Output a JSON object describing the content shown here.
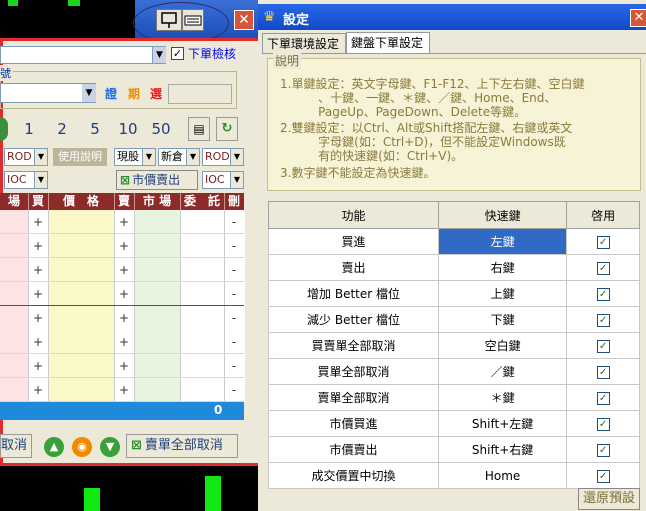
{
  "left_window": {
    "review_label": "下單檢核",
    "account_label": "號",
    "market_tabs": [
      {
        "label": "證",
        "color": "#1f6fe8"
      },
      {
        "label": "期",
        "color": "#f08a00"
      },
      {
        "label": "選",
        "color": "#e82020"
      }
    ],
    "qty_buttons": [
      "1",
      "2",
      "5",
      "10",
      "50"
    ],
    "row_a": {
      "rod1": "ROD",
      "help": "使用說明",
      "spot": "現股",
      "new_pos": "新倉",
      "rod2": "ROD"
    },
    "row_b": {
      "ioc1": "IOC",
      "market_sell": "市價賣出",
      "ioc2": "IOC"
    },
    "grid_headers": [
      "場",
      "買",
      "價　格",
      "賣",
      "市 場",
      "委　託",
      "刪"
    ],
    "grid_rows": [
      {
        "buy": "+",
        "sell": "+",
        "del": "-"
      },
      {
        "buy": "+",
        "sell": "+",
        "del": "-"
      },
      {
        "buy": "+",
        "sell": "+",
        "del": "-"
      },
      {
        "buy": "+",
        "sell": "+",
        "del": "-"
      },
      {
        "buy": "+",
        "sell": "+",
        "del": "-"
      },
      {
        "buy": "+",
        "sell": "+",
        "del": "-"
      },
      {
        "buy": "+",
        "sell": "+",
        "del": "-"
      },
      {
        "buy": "+",
        "sell": "+",
        "del": "-"
      }
    ],
    "grid_total": "0",
    "cancel_label": "取消",
    "cancel_all_sell_label": "賣單全部取消"
  },
  "dialog": {
    "title": "設定",
    "tabs": [
      "下單環境設定",
      "鍵盤下單設定"
    ],
    "note_legend": "說明",
    "notes": [
      "1.單鍵設定：英文字母鍵、F1-F12、上下左右鍵、空白鍵",
      "          、十鍵、一鍵、＊鍵、／鍵、Home、End、",
      "          PageUp、PageDown、Delete等鍵。",
      "2.雙鍵設定：以Ctrl、Alt或Shift搭配左鍵、右鍵或英文",
      "          字母鍵(如：Ctrl+D)，但不能設定Windows既",
      "          有的快速鍵(如：Ctrl+V)。",
      "3.數字鍵不能設定為快速鍵。"
    ],
    "table_headers": [
      "功能",
      "快速鍵",
      "啓用"
    ],
    "rows": [
      {
        "func": "買進",
        "key": "左鍵",
        "enabled": "✓"
      },
      {
        "func": "賣出",
        "key": "右鍵",
        "enabled": "✓"
      },
      {
        "func": "增加 Better 檔位",
        "key": "上鍵",
        "enabled": "✓"
      },
      {
        "func": "減少 Better 檔位",
        "key": "下鍵",
        "enabled": "✓"
      },
      {
        "func": "買賣單全部取消",
        "key": "空白鍵",
        "enabled": "✓"
      },
      {
        "func": "買單全部取消",
        "key": "／鍵",
        "enabled": "✓"
      },
      {
        "func": "賣單全部取消",
        "key": "＊鍵",
        "enabled": "✓"
      },
      {
        "func": "市價買進",
        "key": "Shift+左鍵",
        "enabled": "✓"
      },
      {
        "func": "市價賣出",
        "key": "Shift+右鍵",
        "enabled": "✓"
      },
      {
        "func": "成交價置中切換",
        "key": "Home",
        "enabled": "✓"
      }
    ],
    "restore_label": "還原預設"
  }
}
